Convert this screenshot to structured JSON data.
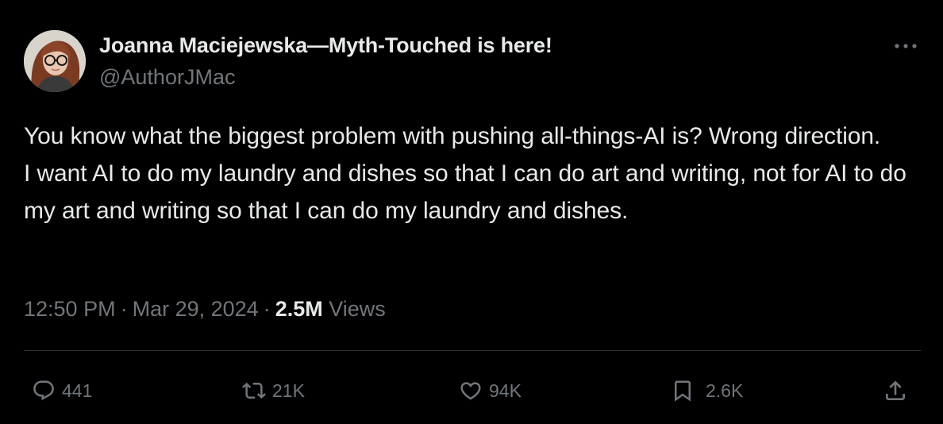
{
  "author": {
    "name": "Joanna Maciejewska—Myth-Touched is here!",
    "handle": "@AuthorJMac"
  },
  "tweet": {
    "lines": [
      "You know what the biggest problem with pushing all-things-AI is? Wrong direction.",
      "I want AI to do my laundry and dishes so that I can do art and writing, not for AI to do my art and writing so that I can do my laundry and dishes."
    ],
    "time": "12:50 PM",
    "date": "Mar 29, 2024",
    "views_count": "2.5M",
    "views_label": "Views"
  },
  "actions": {
    "replies": "441",
    "reposts": "21K",
    "likes": "94K",
    "bookmarks": "2.6K"
  },
  "icons": {
    "more": "more-horizontal-icon",
    "reply": "reply-icon",
    "repost": "repost-icon",
    "like": "heart-icon",
    "bookmark": "bookmark-icon",
    "share": "share-icon"
  },
  "colors": {
    "background": "#000000",
    "text_primary": "#e7e9ea",
    "text_secondary": "#71767b",
    "divider": "#2f3336"
  }
}
